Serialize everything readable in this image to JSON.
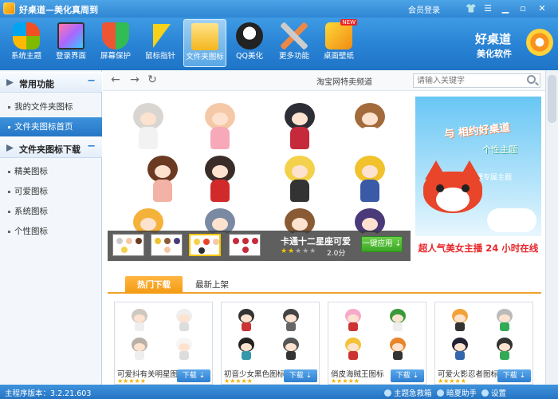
{
  "window": {
    "title": "好桌道—美化真周到",
    "login": "会员登录"
  },
  "toolbar": {
    "items": [
      {
        "label": "系统主题",
        "icon": "windows-logo-icon"
      },
      {
        "label": "登录界面",
        "icon": "login-screen-icon"
      },
      {
        "label": "屏幕保护",
        "icon": "shield-icon"
      },
      {
        "label": "鼠标指针",
        "icon": "cursor-icon"
      },
      {
        "label": "文件夹图标",
        "icon": "folder-icon"
      },
      {
        "label": "QQ美化",
        "icon": "qq-penguin-icon"
      },
      {
        "label": "更多功能",
        "icon": "tools-icon"
      },
      {
        "label": "桌面壁纸",
        "icon": "wallpaper-icon"
      }
    ],
    "active_index": 4,
    "new_badge": "NEW",
    "brand_line1": "好桌道",
    "brand_line2": "美化软件"
  },
  "sidebar": {
    "sections": [
      {
        "title": "常用功能",
        "items": [
          "我的文件夹图标",
          "文件夹图标首页"
        ]
      },
      {
        "title": "文件夹图标下载",
        "items": [
          "精美图标",
          "可爱图标",
          "系统图标",
          "个性图标"
        ]
      }
    ],
    "active_item": "文件夹图标首页"
  },
  "nav": {
    "page_title": "淘宝网特卖频道",
    "search_placeholder": "请输入关键字"
  },
  "banner": {
    "theme_name": "卡通十二星座可爱",
    "rating": 2,
    "rating_max": 5,
    "score": "2.0分",
    "apply_label": "一键应用",
    "selected_thumb": 2
  },
  "ad": {
    "line1": "与    相约好桌道",
    "line2": "个性主题",
    "line3": "—阿狸专属主题",
    "bottom_text": "超人气美女主播 24 小时在线"
  },
  "tabs": {
    "hot": "热门下载",
    "latest": "最新上架"
  },
  "cards": [
    {
      "name": "可爱抖有关明星图",
      "download": "下载"
    },
    {
      "name": "初音少女黑色图标",
      "download": "下载"
    },
    {
      "name": "俏皮海贼王图标",
      "download": "下载"
    },
    {
      "name": "可爱火影忍者图标",
      "download": "下载"
    }
  ],
  "statusbar": {
    "version": "主程序版本：3.2.21.603",
    "item1": "主题急救箱",
    "item2": "暗夏助手",
    "item3": "设置"
  }
}
